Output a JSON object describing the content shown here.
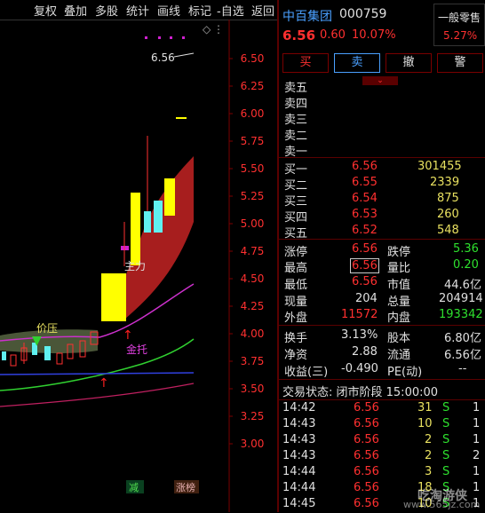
{
  "toolbar": {
    "items": [
      "复权",
      "叠加",
      "多股",
      "统计",
      "画线",
      "标记",
      "-自选",
      "返回"
    ]
  },
  "chart": {
    "price_ticks": [
      "6.50",
      "6.25",
      "6.00",
      "5.75",
      "5.50",
      "5.25",
      "5.00",
      "4.75",
      "4.50",
      "4.25",
      "4.00",
      "3.75",
      "3.50",
      "3.25",
      "3.00"
    ],
    "current_price_label": "6.56",
    "annotations": {
      "jiaya": "价压",
      "jintuo": "金托",
      "zhuli": "主力"
    },
    "bottom_badges": {
      "jian": "减",
      "zhangbang": "涨榜"
    },
    "colors": {
      "up_candle": "#ffff00",
      "down_candle": "#5ff0f0",
      "band": "#b02020",
      "accent": "#ff2020"
    }
  },
  "stock": {
    "name": "中百集团",
    "code": "000759",
    "price": "6.56",
    "change": "0.60",
    "change_pct": "10.07%",
    "retail_label": "一般零售",
    "retail_pct": "5.27%"
  },
  "trade_buttons": {
    "buy": "买",
    "sell": "卖",
    "cancel": "撤",
    "alert": "警"
  },
  "order_book": {
    "sell": [
      {
        "label": "卖五",
        "price": "",
        "vol": ""
      },
      {
        "label": "卖四",
        "price": "",
        "vol": ""
      },
      {
        "label": "卖三",
        "price": "",
        "vol": ""
      },
      {
        "label": "卖二",
        "price": "",
        "vol": ""
      },
      {
        "label": "卖一",
        "price": "",
        "vol": ""
      }
    ],
    "buy": [
      {
        "label": "买一",
        "price": "6.56",
        "vol": "301455"
      },
      {
        "label": "买二",
        "price": "6.55",
        "vol": "2339"
      },
      {
        "label": "买三",
        "price": "6.54",
        "vol": "875"
      },
      {
        "label": "买四",
        "price": "6.53",
        "vol": "260"
      },
      {
        "label": "买五",
        "price": "6.52",
        "vol": "548"
      }
    ]
  },
  "stats": {
    "zhangting": {
      "label": "涨停",
      "value": "6.56"
    },
    "dieting": {
      "label": "跌停",
      "value": "5.36"
    },
    "zuigao": {
      "label": "最高",
      "value": "6.56"
    },
    "liangbi": {
      "label": "量比",
      "value": "0.20"
    },
    "zuidi": {
      "label": "最低",
      "value": "6.56"
    },
    "shizhi": {
      "label": "市值",
      "value": "44.6亿"
    },
    "xianliang": {
      "label": "现量",
      "value": "204"
    },
    "zongliang": {
      "label": "总量",
      "value": "204914"
    },
    "waipan": {
      "label": "外盘",
      "value": "11572"
    },
    "neipan": {
      "label": "内盘",
      "value": "193342"
    },
    "huanshou": {
      "label": "换手",
      "value": "3.13%"
    },
    "guben": {
      "label": "股本",
      "value": "6.80亿"
    },
    "jingzi": {
      "label": "净资",
      "value": "2.88"
    },
    "liutong": {
      "label": "流通",
      "value": "6.56亿"
    },
    "shouyi": {
      "label": "收益(三)",
      "value": "-0.490"
    },
    "pe": {
      "label": "PE(动)",
      "value": "--"
    }
  },
  "trade_status": "交易状态: 闭市阶段 15:00:00",
  "ticks": [
    {
      "time": "14:42",
      "price": "6.56",
      "vol": "31",
      "side": "S",
      "n": "1"
    },
    {
      "time": "14:43",
      "price": "6.56",
      "vol": "10",
      "side": "S",
      "n": "1"
    },
    {
      "time": "14:43",
      "price": "6.56",
      "vol": "2",
      "side": "S",
      "n": "1"
    },
    {
      "time": "14:43",
      "price": "6.56",
      "vol": "2",
      "side": "S",
      "n": "2"
    },
    {
      "time": "14:44",
      "price": "6.56",
      "vol": "3",
      "side": "S",
      "n": "1"
    },
    {
      "time": "14:44",
      "price": "6.56",
      "vol": "18",
      "side": "S",
      "n": "1"
    },
    {
      "time": "14:45",
      "price": "6.56",
      "vol": "10",
      "side": "S",
      "n": "1"
    }
  ],
  "watermark": {
    "main": "吃淘游侠",
    "url": "www.565jz.com"
  }
}
